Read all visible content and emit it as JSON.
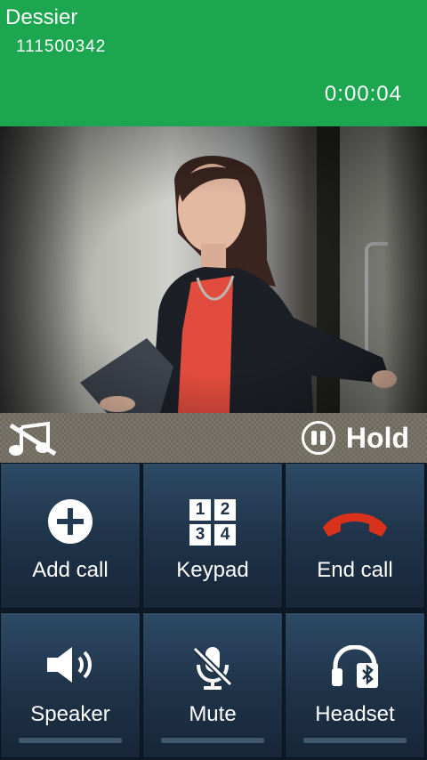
{
  "call": {
    "caller_name": "Dessier",
    "caller_number": "111500342",
    "timer": "0:00:04",
    "header_color": "#1ba64f"
  },
  "controls": {
    "music_icon": "music-off-icon",
    "hold_label": "Hold"
  },
  "buttons": {
    "add_call": "Add call",
    "keypad": "Keypad",
    "keypad_digits": [
      "1",
      "2",
      "3",
      "4"
    ],
    "end_call": "End call",
    "end_call_color": "#d9321c",
    "speaker": "Speaker",
    "mute": "Mute",
    "headset": "Headset"
  }
}
